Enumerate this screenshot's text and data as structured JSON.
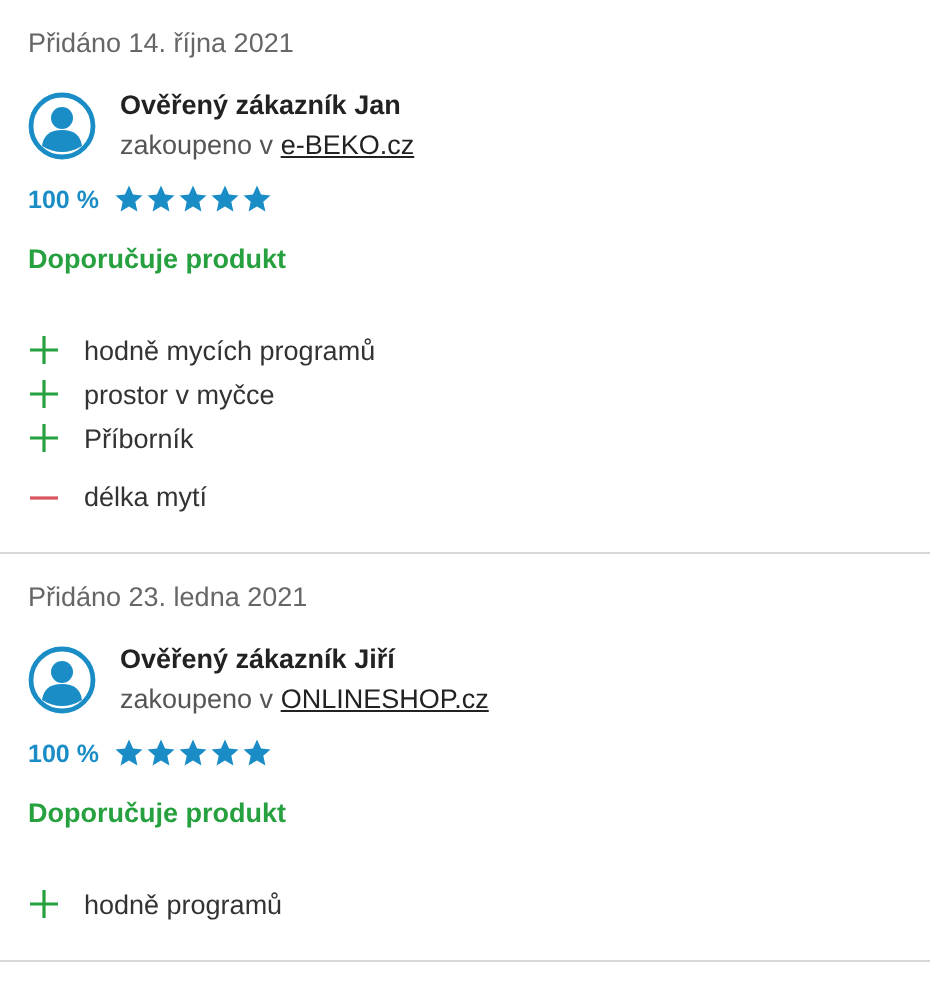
{
  "reviews": [
    {
      "date": "Přidáno 14. října 2021",
      "author": "Ověřený zákazník Jan",
      "purchased": "zakoupeno v",
      "shop": "e-BEKO.cz",
      "percent": "100 %",
      "stars": 5,
      "recommendation": "Doporučuje produkt",
      "points": [
        {
          "kind": "pro",
          "text": "hodně mycích programů"
        },
        {
          "kind": "pro",
          "text": "prostor v myčce"
        },
        {
          "kind": "pro",
          "text": "Příborník"
        },
        {
          "kind": "con",
          "text": "délka mytí"
        }
      ]
    },
    {
      "date": "Přidáno 23. ledna 2021",
      "author": "Ověřený zákazník Jiří",
      "purchased": "zakoupeno v",
      "shop": "ONLINESHOP.cz",
      "percent": "100 %",
      "stars": 5,
      "recommendation": "Doporučuje produkt",
      "points": [
        {
          "kind": "pro",
          "text": "hodně programů"
        }
      ]
    }
  ]
}
